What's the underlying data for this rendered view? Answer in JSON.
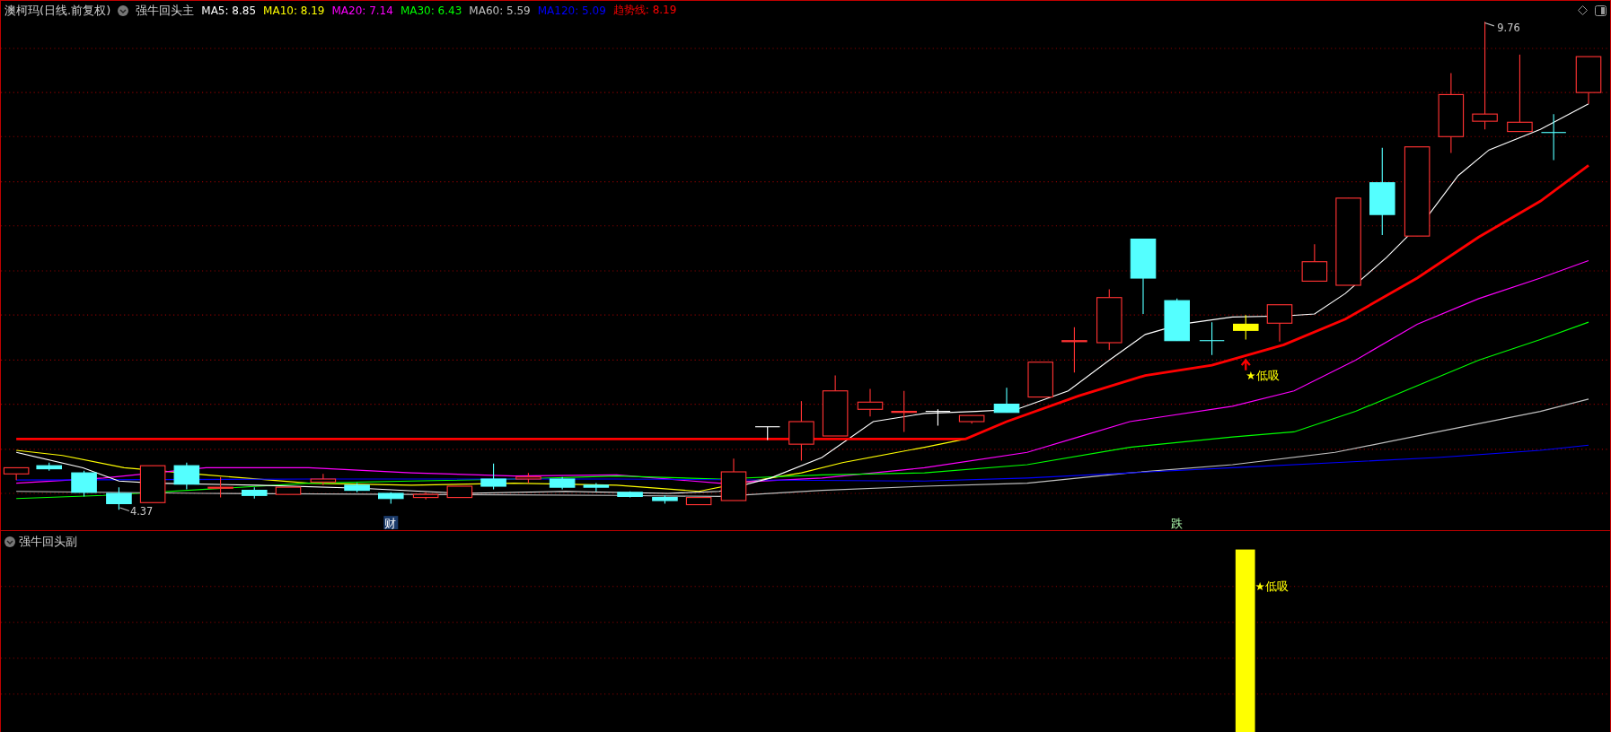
{
  "header": {
    "title": "澳柯玛(日线.前复权)",
    "indicator": "强牛回头主",
    "averages": [
      {
        "label": "MA5: 8.85",
        "color": "#ffffff"
      },
      {
        "label": "MA10: 8.19",
        "color": "#ffff00"
      },
      {
        "label": "MA20: 7.14",
        "color": "#ff00ff"
      },
      {
        "label": "MA30: 6.43",
        "color": "#00ff00"
      },
      {
        "label": "MA60: 5.59",
        "color": "#c0c0c0"
      },
      {
        "label": "MA120: 5.09",
        "color": "#0000ff"
      },
      {
        "label": "趋势线: 8.19",
        "color": "#ff0000"
      }
    ]
  },
  "main_chart": {
    "markers": [
      {
        "kind": "high",
        "text": "9.76"
      },
      {
        "kind": "low",
        "text": "4.37"
      },
      {
        "kind": "finance",
        "text": "财"
      },
      {
        "kind": "fall",
        "text": "跌"
      },
      {
        "kind": "signal",
        "text": "★低吸"
      }
    ]
  },
  "sub_panel": {
    "title": "强牛回头副",
    "signal": "★低吸"
  }
}
